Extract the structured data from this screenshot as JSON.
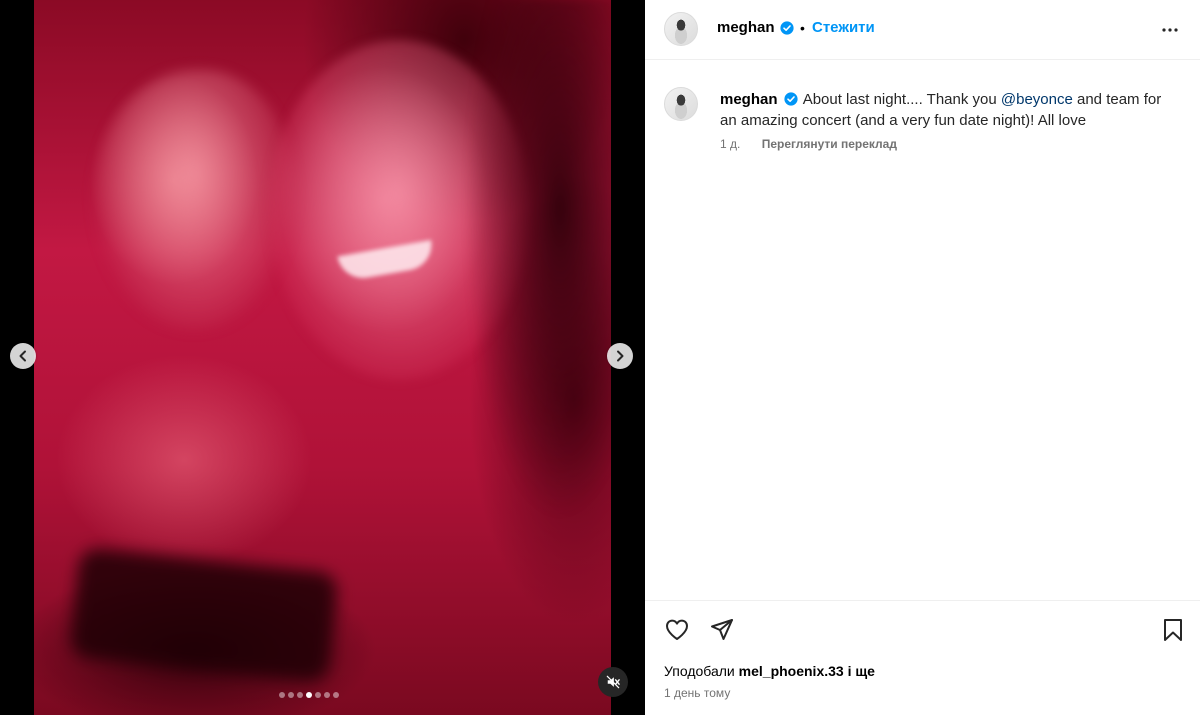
{
  "post": {
    "author": "meghan",
    "follow_label": "Стежити",
    "separator": "•",
    "caption_lead": "About last night.... Thank you ",
    "caption_mention": "@beyonce",
    "caption_tail": " and team for an amazing concert (and a very fun date night)! All love",
    "age": "1 д.",
    "translate_label": "Переглянути переклад",
    "likes_prefix": "Уподобали ",
    "likes_user": "mel_phoenix.33",
    "likes_suffix": " і ще",
    "time_ago": "1 день тому"
  },
  "carousel": {
    "total_slides": 7,
    "active_slide": 4
  },
  "icons": {
    "verified": "verified-badge-icon",
    "more": "more-options-icon",
    "like": "heart-icon",
    "share": "share-icon",
    "save": "bookmark-icon",
    "prev": "chevron-left-icon",
    "next": "chevron-right-icon",
    "mute": "speaker-muted-icon"
  },
  "colors": {
    "accent": "#0095f6",
    "verified": "#0095f6",
    "mention": "#00376b",
    "secondary_text": "#737373"
  }
}
